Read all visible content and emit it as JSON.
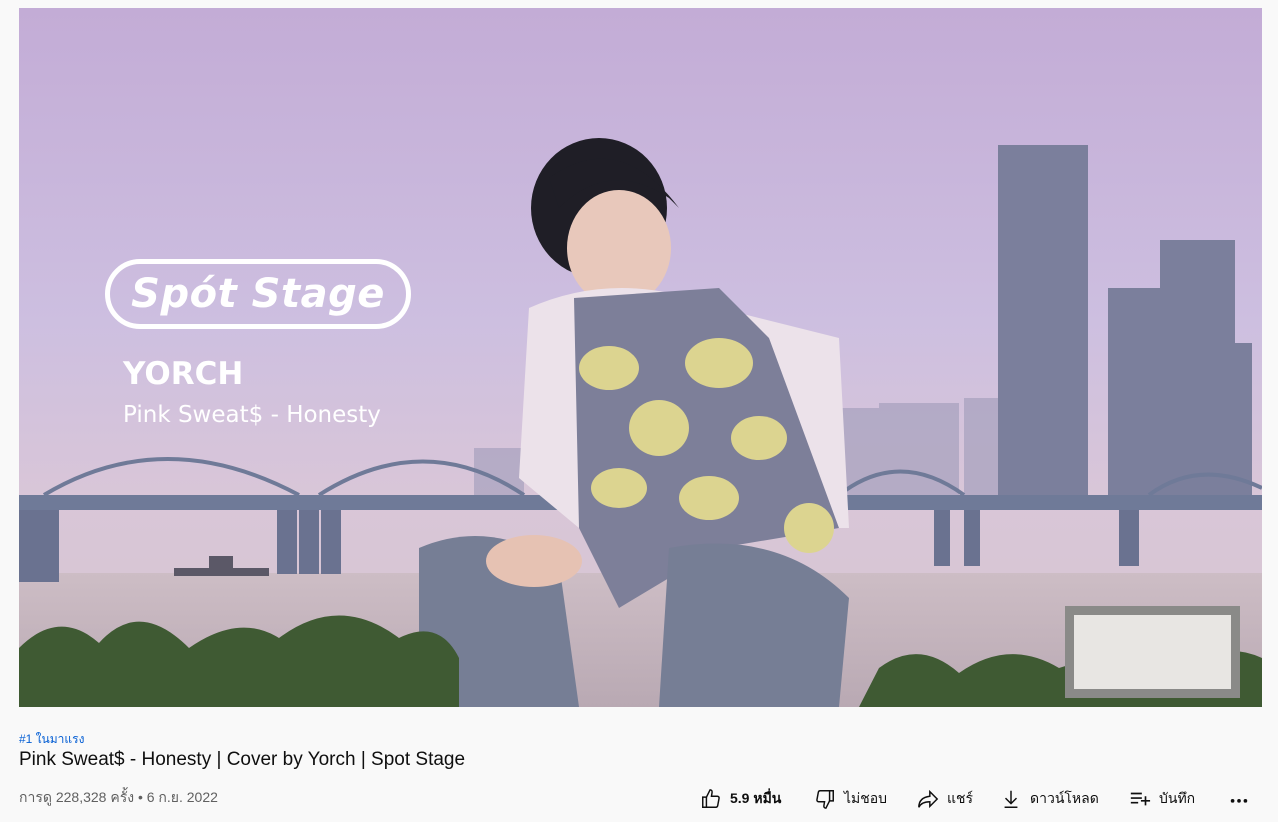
{
  "video": {
    "overlay": {
      "logo_text": "Spót Stage",
      "artist": "YORCH",
      "song": "Pink Sweat$ - Honesty"
    }
  },
  "info": {
    "trending_badge": "#1 ในมาแรง",
    "title": "Pink Sweat$ - Honesty | Cover by Yorch | Spot Stage",
    "views_date": "การดู 228,328 ครั้ง • 6 ก.ย. 2022"
  },
  "actions": {
    "like_count": "5.9 หมื่น",
    "dislike_label": "ไม่ชอบ",
    "share_label": "แชร์",
    "download_label": "ดาวน์โหลด",
    "save_label": "บันทึก",
    "like_icon": "thumbs-up-icon",
    "dislike_icon": "thumbs-down-icon",
    "share_icon": "share-arrow-icon",
    "download_icon": "download-icon",
    "save_icon": "playlist-add-icon",
    "more_icon": "more-horizontal-icon"
  },
  "colors": {
    "link_blue": "#065fd4",
    "secondary_text": "#606060",
    "page_bg": "#f9f9f9"
  }
}
